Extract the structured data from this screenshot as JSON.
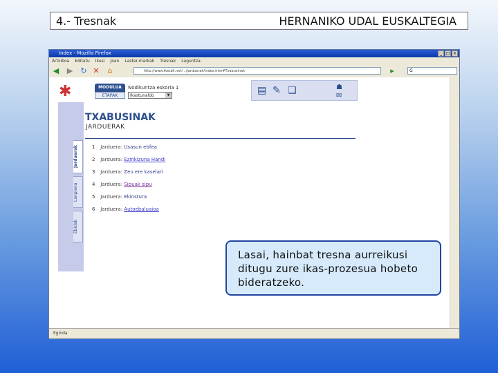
{
  "slide": {
    "title": "4.- Tresnak",
    "org": "HERNANIKO UDAL EUSKALTEGIA"
  },
  "browser": {
    "window_title": "Index - Mozilla Firefox",
    "menu": [
      "Artxiboa",
      "Editatu",
      "Ikusi",
      "Joan",
      "Laster-markak",
      "Tresnak",
      "Laguntza"
    ],
    "url": "http://www.ikasbil.net/.../jarduerak/index.htm#Txabusinak",
    "search_placeholder": "G",
    "status": "Eginda"
  },
  "page": {
    "logo_icon": "ikasbil-logo",
    "module_tab": "MODULUA",
    "stage_tab": "ETAPAK",
    "module_name": "Nodikuntza eskoria 1",
    "stage_select": "Ikastunaldo",
    "title": "TXABUSINAK",
    "subtitle": "JARDUERAK",
    "sidebar_tabs": [
      "Jarduerak",
      "Lanplana",
      "Ebidak"
    ]
  },
  "activities": [
    {
      "num": "1",
      "label": "Jarduera:",
      "value": "Usasun ebfea",
      "style": "plain"
    },
    {
      "num": "2",
      "label": "Jarduera:",
      "value": "Ezinkizuna Handi",
      "style": "link"
    },
    {
      "num": "3",
      "label": "Jarduera:",
      "value": "Zeu ere kaselari",
      "style": "plain"
    },
    {
      "num": "4",
      "label": "Jarduera:",
      "value": "Sipuak sipu",
      "style": "visited"
    },
    {
      "num": "5",
      "label": "Jarduera:",
      "value": "Ekinstura",
      "style": "plain"
    },
    {
      "num": "6",
      "label": "Jarduera:",
      "value": "Autoebaluaioa",
      "style": "link"
    }
  ],
  "callout": {
    "text": "Lasai, hainbat tresna aurreikusi ditugu zure ikas-prozesua hobeto bideratzeko."
  }
}
